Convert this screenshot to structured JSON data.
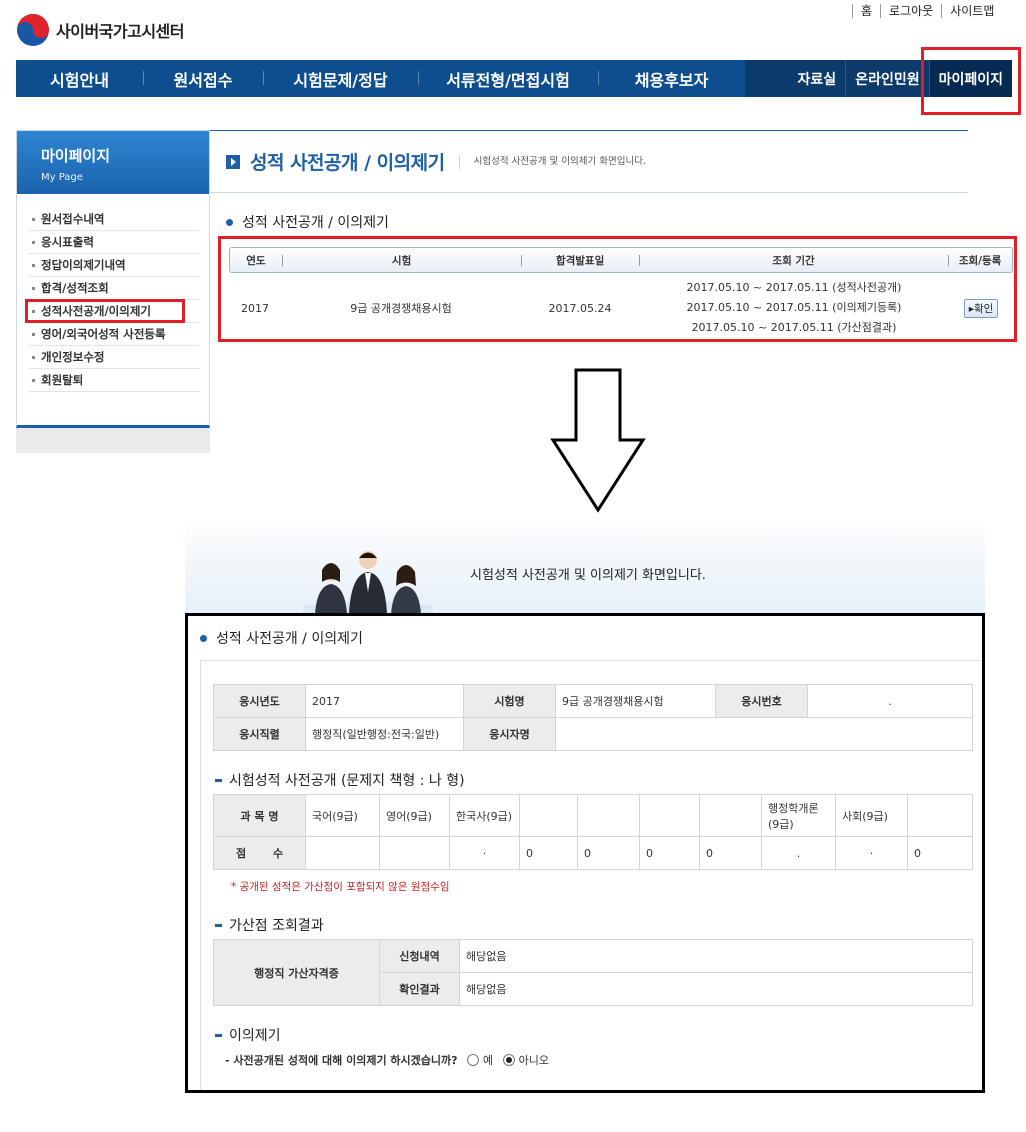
{
  "site": {
    "title": "사이버국가고시센터"
  },
  "util_links": [
    "홈",
    "로그아웃",
    "사이트맵"
  ],
  "gnb": {
    "main": [
      "시험안내",
      "원서접수",
      "시험문제/정답",
      "서류전형/면접시험",
      "채용후보자"
    ],
    "sub": [
      "자료실",
      "온라인민원",
      "마이페이지"
    ]
  },
  "lnb": {
    "title": "마이페이지",
    "subtitle": "My Page",
    "items": [
      "원서접수내역",
      "응시표출력",
      "정답이의제기내역",
      "합격/성적조회",
      "성적사전공개/이의제기",
      "영어/외국어성적 사전등록",
      "개인정보수정",
      "회원탈퇴"
    ]
  },
  "page_header": {
    "title": "성적 사전공개 / 이의제기",
    "desc": "시험성적 사전공개 및 이의제기 화면입니다."
  },
  "list_section": {
    "title": "성적 사전공개 / 이의제기",
    "headers": [
      "연도",
      "시험",
      "합격발표일",
      "조회 기간",
      "조회/등록"
    ],
    "row": {
      "year": "2017",
      "exam": "9급 공개경쟁채용시험",
      "announce_date": "2017.05.24",
      "periods": [
        "2017.05.10 ~ 2017.05.11 (성적사전공개)",
        "2017.05.10 ~ 2017.05.11 (이의제기등록)",
        "2017.05.10 ~ 2017.05.11 (가산점결과)"
      ],
      "button": "확인"
    }
  },
  "banner": {
    "text": "시험성적 사전공개 및 이의제기 화면입니다."
  },
  "detail": {
    "title": "성적 사전공개 / 이의제기",
    "info": {
      "year_label": "응시년도",
      "year": "2017",
      "exam_label": "시험명",
      "exam": "9급 공개경쟁채용시험",
      "number_label": "응시번호",
      "number": ".",
      "job_label": "응시직렬",
      "job": "행정직(일반행정:전국:일반)",
      "name_label": "응시자명",
      "name": ""
    },
    "score_section": {
      "title": "시험성적 사전공개 (문제지 책형 : 나 형)",
      "subject_label": "과 목 명",
      "score_label": "점       수",
      "subjects": [
        "국어(9급)",
        "영어(9급)",
        "한국사(9급)",
        "",
        "",
        "",
        "",
        "행정학개론(9급)",
        "사회(9급)",
        ""
      ],
      "scores": [
        "",
        "",
        "·",
        "0",
        "0",
        "0",
        "0",
        ".",
        "·",
        "0"
      ],
      "note": "* 공개된 성적은 가산점이 포함되지 않은 원점수임"
    },
    "bonus_section": {
      "title": "가산점 조회결과",
      "category": "행정직 가산자격증",
      "apply_label": "신청내역",
      "apply_value": "해당없음",
      "result_label": "확인결과",
      "result_value": "해당없음"
    },
    "objection": {
      "title": "이의제기",
      "question": "- 사전공개된 성적에 대해 이의제기 하시겠습니까?",
      "yes": "예",
      "no": "아니오",
      "selected": "no"
    }
  },
  "colors": {
    "brand": "#0e4d8e",
    "highlight": "#e21f26",
    "accent": "#1e5fa6"
  }
}
